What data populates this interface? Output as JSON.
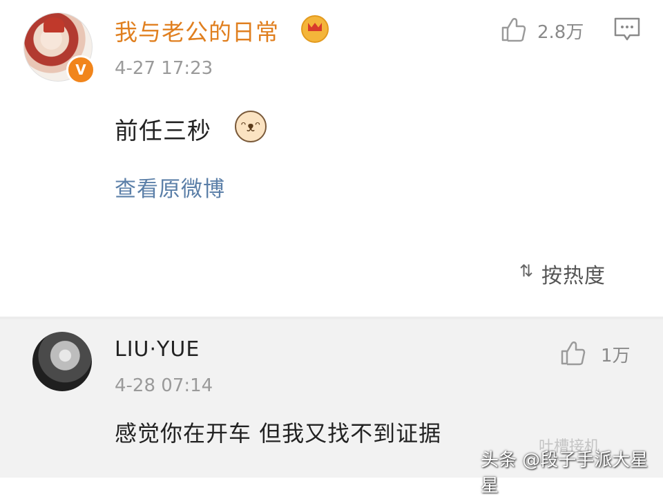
{
  "post": {
    "username": "我与老公的日常",
    "badge": "V",
    "timestamp": "4-27 17:23",
    "text": "前任三秒",
    "emoji": "cat-face",
    "view_original": "查看原微博",
    "like_count": "2.8万"
  },
  "sort": {
    "label": "按热度"
  },
  "reply": {
    "username": "LIU·YUE",
    "timestamp": "4-28 07:14",
    "text": "感觉你在开车 但我又找不到证据",
    "like_count": "1万"
  },
  "watermarks": {
    "faint": "吐槽接机",
    "main": "头条 @段子手派大星星"
  },
  "colors": {
    "username_orange": "#e07f1f",
    "link_blue": "#5b7fa8",
    "badge_orange": "#f1851c",
    "reply_background": "#f2f2f2"
  }
}
